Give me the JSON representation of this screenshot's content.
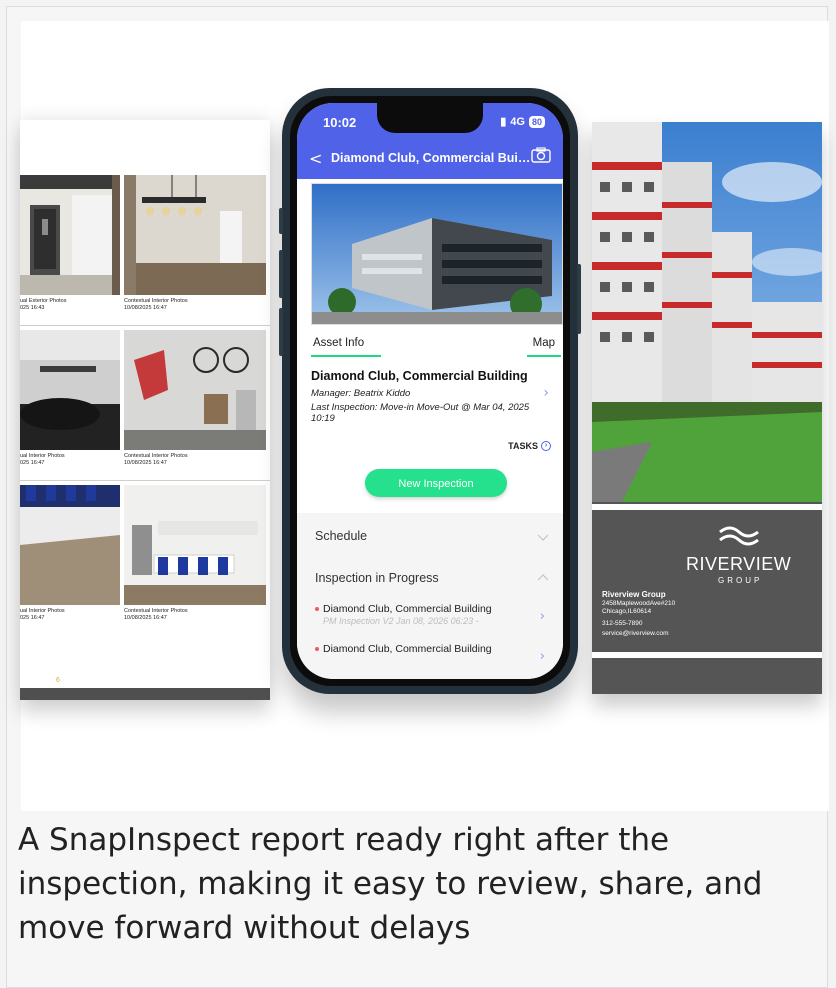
{
  "caption": "A SnapInspect report ready right after the inspection, making it easy to review, share, and move forward without delays",
  "report": {
    "photos": [
      {
        "caption_title": "ual Exterior Photos",
        "caption_date": "025 16:43"
      },
      {
        "caption_title": "Contextual Interior Photos",
        "caption_date": "10/08/2025 16:47"
      },
      {
        "caption_title": "ual Interior Photos",
        "caption_date": "025 16:47"
      },
      {
        "caption_title": "Contextual Interior Photos",
        "caption_date": "10/08/2025 16:47"
      },
      {
        "caption_title": "ual Interior Photos",
        "caption_date": "025 16:47"
      },
      {
        "caption_title": "Contextual Interior Photos",
        "caption_date": "10/08/2025 16:47"
      }
    ],
    "page_number": "6"
  },
  "phone": {
    "status_time": "10:02",
    "status_network": "4G",
    "status_battery": "80",
    "nav_back": "<",
    "nav_title": "Diamond Club, Commercial Build...",
    "tab_asset": "Asset Info",
    "tab_map": "Map",
    "asset_name": "Diamond Club, Commercial Building",
    "manager": "Manager: Beatrix Kiddo",
    "last_inspection": "Last Inspection: Move-in Move-Out @ Mar 04, 2025 10:19",
    "tasks_label": "TASKS",
    "new_inspection_label": "New Inspection",
    "schedule_label": "Schedule",
    "in_progress_label": "Inspection in Progress",
    "in_progress_items": [
      {
        "title": "Diamond Club, Commercial Building",
        "subtitle": "PM Inspection V2  Jan 08, 2026 06:23 -"
      },
      {
        "title": "Diamond Club, Commercial Building",
        "subtitle": ""
      }
    ],
    "accent": "#4f62e8",
    "green": "#25e08c"
  },
  "brochure": {
    "logo_main": "RIVERVIEW",
    "logo_sub": "GROUP",
    "company": "Riverview Group",
    "address1": "2458MaplewoodAve#210",
    "address2": "Chicago,IL60614",
    "phone": "312-555-7890",
    "email": "service@riverview.com"
  }
}
